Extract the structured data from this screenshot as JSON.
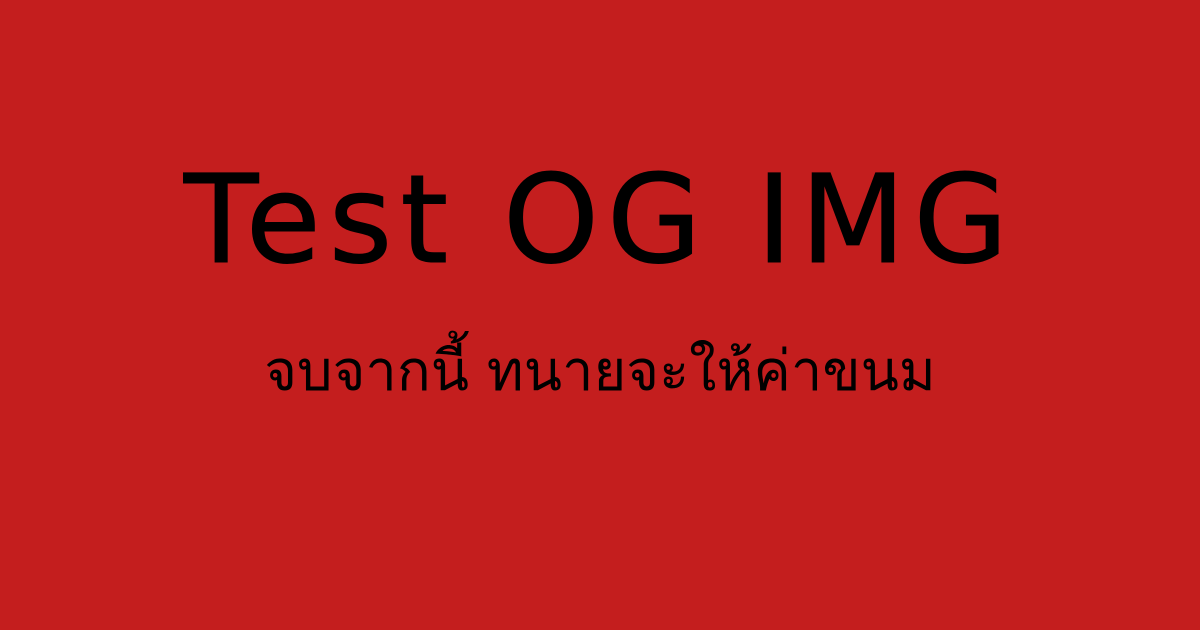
{
  "og_image": {
    "title": "Test OG IMG",
    "subtitle": "จบจากนี้ ทนายจะให้ค่าขนม",
    "background_color": "#C41E1E",
    "text_color": "#000000"
  }
}
